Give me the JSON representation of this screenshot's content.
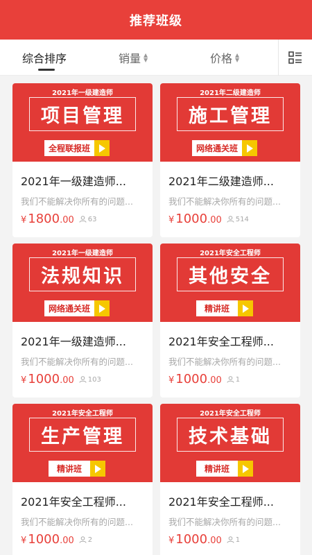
{
  "header": {
    "title": "推荐班级"
  },
  "sort_bar": {
    "tabs": [
      {
        "label": "综合排序",
        "active": true
      },
      {
        "label": "销量",
        "active": false
      },
      {
        "label": "价格",
        "active": false
      }
    ],
    "view_toggle_icon": "list-view-icon"
  },
  "colors": {
    "brand_red": "#e8403a",
    "badge_yellow": "#f6c700"
  },
  "courses": [
    {
      "cover_subtitle": "2021年一级建造师",
      "cover_title": "项目管理",
      "cover_badge": "全程联报班",
      "title": "2021年一级建造师...",
      "description": "我们不能解决你所有的问题...",
      "price_currency": "¥",
      "price_integer": "1800",
      "price_decimal": ".00",
      "students": "63"
    },
    {
      "cover_subtitle": "2021年二级建造师",
      "cover_title": "施工管理",
      "cover_badge": "网络通关班",
      "title": "2021年二级建造师...",
      "description": "我们不能解决你所有的问题...",
      "price_currency": "¥",
      "price_integer": "1000",
      "price_decimal": ".00",
      "students": "514"
    },
    {
      "cover_subtitle": "2021年一级建造师",
      "cover_title": "法规知识",
      "cover_badge": "网络通关班",
      "title": "2021年一级建造师...",
      "description": "我们不能解决你所有的问题...",
      "price_currency": "¥",
      "price_integer": "1000",
      "price_decimal": ".00",
      "students": "103"
    },
    {
      "cover_subtitle": "2021年安全工程师",
      "cover_title": "其他安全",
      "cover_badge": "精讲班",
      "title": "2021年安全工程师...",
      "description": "我们不能解决你所有的问题...",
      "price_currency": "¥",
      "price_integer": "1000",
      "price_decimal": ".00",
      "students": "1"
    },
    {
      "cover_subtitle": "2021年安全工程师",
      "cover_title": "生产管理",
      "cover_badge": "精讲班",
      "title": "2021年安全工程师...",
      "description": "我们不能解决你所有的问题...",
      "price_currency": "¥",
      "price_integer": "1000",
      "price_decimal": ".00",
      "students": "2"
    },
    {
      "cover_subtitle": "2021年安全工程师",
      "cover_title": "技术基础",
      "cover_badge": "精讲班",
      "title": "2021年安全工程师...",
      "description": "我们不能解决你所有的问题...",
      "price_currency": "¥",
      "price_integer": "1000",
      "price_decimal": ".00",
      "students": "1"
    }
  ]
}
